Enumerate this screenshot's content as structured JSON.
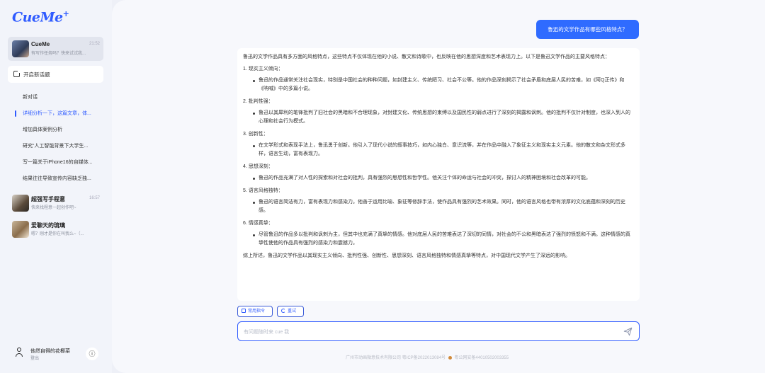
{
  "app": {
    "logo": "CueMe",
    "logo_mark": "+"
  },
  "sidebar": {
    "active_agent": {
      "name": "CueMe",
      "time": "21:52",
      "subtitle": "有写作任务吗？快来试试我..."
    },
    "new_chat_label": "开启新话题",
    "topics": [
      {
        "label": "新对话",
        "active": false
      },
      {
        "label": "详细分析一下，这篇文章，体...",
        "active": true
      },
      {
        "label": "增加具体案例分析",
        "active": false
      },
      {
        "label": "研究“人工智能背景下大学生...",
        "active": false
      },
      {
        "label": "写一篇关于iPhone16的自媒体...",
        "active": false
      },
      {
        "label": "结果往往导致宣传内容缺乏独...",
        "active": false
      }
    ],
    "agents": [
      {
        "name": "超强写手程意",
        "time": "16:57",
        "subtitle": "快来找程意一起创作吧~"
      },
      {
        "name": "爱聊天的琉璃",
        "time": "",
        "subtitle": "嗯？刚才是你在叫我么~（..."
      }
    ],
    "user": {
      "name": "他然自得的花椰菜",
      "action": "登出"
    }
  },
  "chat": {
    "question": "鲁迅的文学作品有哪些风格特点？",
    "answer": {
      "intro": "鲁迅的文学作品具有多方面的风格特点，这些特点不仅体现在他的小说、散文和诗歌中，也反映在他的思想深度和艺术表现力上。以下是鲁迅文学作品的主要风格特点：",
      "sections": [
        {
          "heading": "1. 现实主义倾向：",
          "bullet": "鲁迅的作品通常关注社会现实，特别是中国社会的种种问题，如封建主义、传统陋习、社会不公等。他的作品深刻揭示了社会矛盾和底层人民的苦难，如《阿Q正传》和《呐喊》中的多篇小说。"
        },
        {
          "heading": "2. 批判性强：",
          "bullet": "鲁迅以其犀利的笔锋批判了旧社会的黑暗和不合理现象，对封建文化、传统思想的束缚以及国民性的弱点进行了深刻的揭露和讽刺。他的批判不仅针对制度，也深入到人的心理和社会行为模式。"
        },
        {
          "heading": "3. 创新性：",
          "bullet": "在文学形式和表现手法上，鲁迅勇于创新。他引入了现代小说的叙事技巧，如内心独白、意识流等，并在作品中融入了象征主义和现实主义元素。他的散文和杂文形式多样，语言生动，富有表现力。"
        },
        {
          "heading": "4. 思想深刻：",
          "bullet": "鲁迅的作品充满了对人性的探索和对社会的批判，具有强烈的思想性和哲学性。他关注个体的命运与社会的冲突，探讨人的精神困境和社会改革的可能。"
        },
        {
          "heading": "5. 语言风格独特：",
          "bullet": "鲁迅的语言简洁有力，富有表现力和感染力。他善于运用比喻、象征等修辞手法，使作品具有强烈的艺术效果。同时，他的语言风格也带有浓厚的文化底蕴和深刻的历史感。"
        },
        {
          "heading": "6. 情感真挚：",
          "bullet": "尽管鲁迅的作品多以批判和讽刺为主，但其中也充满了真挚的情感。他对底层人民的苦难表达了深切的同情，对社会的不公和黑暗表达了强烈的愤怒和不满。这种情感的真挚性使他的作品具有强烈的感染力和震撼力。"
        }
      ],
      "summary": "综上所述，鲁迅的文学作品以其现实主义倾向、批判性强、创新性、思想深刻、语言风格独特和情感真挚等特点，对中国现代文学产生了深远的影响。"
    },
    "chips": {
      "common_commands": "常用指令",
      "retry": "重试"
    },
    "input_placeholder": "有问题随时来 cue 我"
  },
  "footer": {
    "icp": "广州市动画微意技术有限公司 粤ICP备2022013084号",
    "police": "粤公网安备44010502003355"
  },
  "colors": {
    "accent": "#2f5bff",
    "bubble": "#2f6bff"
  },
  "icons": {
    "new_chat": "edit-icon",
    "send": "send-icon",
    "info": "info-icon",
    "user": "user-icon"
  }
}
